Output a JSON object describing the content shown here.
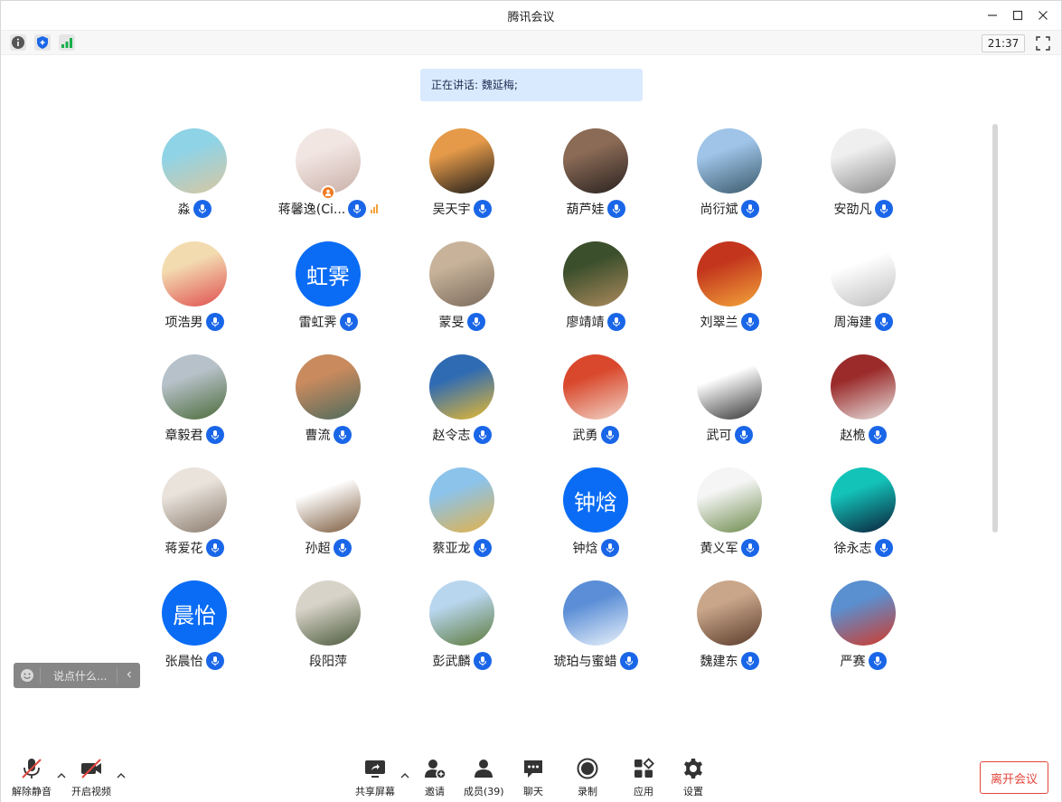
{
  "window": {
    "title": "腾讯会议"
  },
  "infobar": {
    "time": "21:37"
  },
  "speaking": {
    "text": "正在讲话: 魏延梅;"
  },
  "participants": [
    {
      "name": "淼",
      "avatar_text": "",
      "colors": [
        "#8fd3e6",
        "#d8c7a1"
      ]
    },
    {
      "name": "蒋馨逸(Ci...",
      "avatar_text": "",
      "colors": [
        "#f2e6e3",
        "#c9b0a8"
      ],
      "host": true,
      "speaking": true
    },
    {
      "name": "吴天宇",
      "avatar_text": "",
      "colors": [
        "#e59a49",
        "#1a1a1a"
      ]
    },
    {
      "name": "葫芦娃",
      "avatar_text": "",
      "colors": [
        "#8b6b56",
        "#2a2220"
      ]
    },
    {
      "name": "尚衍斌",
      "avatar_text": "",
      "colors": [
        "#9fc4e8",
        "#3a5a6b"
      ]
    },
    {
      "name": "安劭凡",
      "avatar_text": "",
      "colors": [
        "#efefef",
        "#8a8a8a"
      ]
    },
    {
      "name": "项浩男",
      "avatar_text": "",
      "colors": [
        "#f3dbb0",
        "#e04f4f"
      ]
    },
    {
      "name": "雷虹霁",
      "avatar_text": "虹霁",
      "colors": [
        "#0a6cf5",
        "#0a6cf5"
      ]
    },
    {
      "name": "蒙旻",
      "avatar_text": "",
      "colors": [
        "#c8b39a",
        "#7b6b5d"
      ]
    },
    {
      "name": "廖靖靖",
      "avatar_text": "",
      "colors": [
        "#3b4f2c",
        "#ad8a5d"
      ]
    },
    {
      "name": "刘翠兰",
      "avatar_text": "",
      "colors": [
        "#c3361d",
        "#f3a53a"
      ],
      "mic_style": "plain"
    },
    {
      "name": "周海建",
      "avatar_text": "",
      "colors": [
        "#ffffff",
        "#bfbfbf"
      ]
    },
    {
      "name": "章毅君",
      "avatar_text": "",
      "colors": [
        "#b7c1c9",
        "#4c6b3a"
      ]
    },
    {
      "name": "曹流",
      "avatar_text": "",
      "colors": [
        "#c98a5e",
        "#4c6b5e"
      ]
    },
    {
      "name": "赵令志",
      "avatar_text": "",
      "colors": [
        "#2f6bb3",
        "#e8b930"
      ]
    },
    {
      "name": "武勇",
      "avatar_text": "",
      "colors": [
        "#d9482c",
        "#f1d5c8"
      ]
    },
    {
      "name": "武可",
      "avatar_text": "",
      "colors": [
        "#ffffff",
        "#333333"
      ]
    },
    {
      "name": "赵桅",
      "avatar_text": "",
      "colors": [
        "#9b2b2b",
        "#e6e1de"
      ]
    },
    {
      "name": "蒋爱花",
      "avatar_text": "",
      "colors": [
        "#e9e3dc",
        "#8a7a6c"
      ]
    },
    {
      "name": "孙超",
      "avatar_text": "",
      "colors": [
        "#ffffff",
        "#7b5a3c"
      ]
    },
    {
      "name": "蔡亚龙",
      "avatar_text": "",
      "colors": [
        "#8cc3ea",
        "#e3b24a"
      ]
    },
    {
      "name": "钟焓",
      "avatar_text": "钟焓",
      "colors": [
        "#0a6cf5",
        "#0a6cf5"
      ]
    },
    {
      "name": "黄义军",
      "avatar_text": "",
      "colors": [
        "#f5f5f5",
        "#6b8a4a"
      ]
    },
    {
      "name": "徐永志",
      "avatar_text": "",
      "colors": [
        "#13c3b8",
        "#0b1f3a"
      ]
    },
    {
      "name": "张晨怡",
      "avatar_text": "晨怡",
      "colors": [
        "#0a6cf5",
        "#0a6cf5"
      ]
    },
    {
      "name": "段阳萍",
      "avatar_text": "",
      "colors": [
        "#d8d3c9",
        "#4b5a3b"
      ],
      "muted": true
    },
    {
      "name": "彭武麟",
      "avatar_text": "",
      "colors": [
        "#b9d6ef",
        "#5c7a3b"
      ]
    },
    {
      "name": "琥珀与蜜蜡",
      "avatar_text": "",
      "colors": [
        "#5b8ed6",
        "#eaf2fb"
      ]
    },
    {
      "name": "魏建东",
      "avatar_text": "",
      "colors": [
        "#c9a68a",
        "#5b3b2b"
      ]
    },
    {
      "name": "严赛",
      "avatar_text": "",
      "colors": [
        "#5a8fd0",
        "#d23a2a"
      ]
    }
  ],
  "chat": {
    "placeholder": "说点什么..."
  },
  "toolbar": {
    "unmute": "解除静音",
    "video": "开启视频",
    "share": "共享屏幕",
    "invite": "邀请",
    "members": "成员(39)",
    "chat": "聊天",
    "record": "录制",
    "apps": "应用",
    "settings": "设置",
    "leave": "离开会议"
  },
  "colors": {
    "accent": "#1a66e8",
    "avatar_blue": "#0a6cf5",
    "leave": "#e2463d",
    "speaking_bg": "#d9eafe"
  }
}
